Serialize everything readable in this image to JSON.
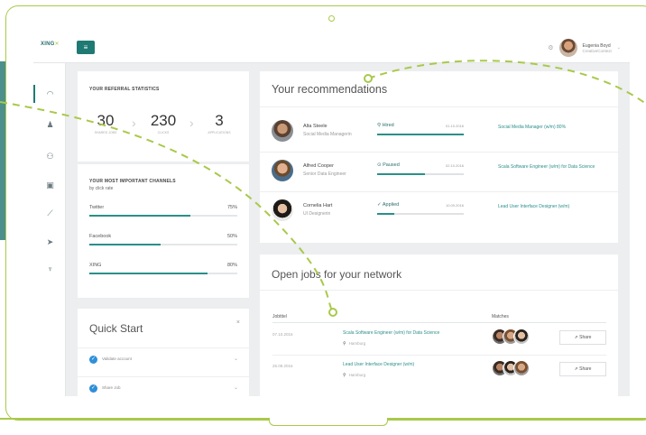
{
  "brand": {
    "logo_text": "XING",
    "accent": "#1f7a73",
    "highlight": "#a9c94a",
    "link": "#2a8f89"
  },
  "topbar": {
    "user_name": "Eugenia Boyd",
    "user_company": "CreativeContext"
  },
  "sidebar": {
    "items": [
      {
        "icon": "dashboard-icon"
      },
      {
        "icon": "person-icon"
      },
      {
        "icon": "people-icon"
      },
      {
        "icon": "briefcase-icon"
      },
      {
        "icon": "chart-icon"
      },
      {
        "icon": "send-icon"
      },
      {
        "icon": "trophy-icon"
      }
    ]
  },
  "referral_stats": {
    "title": "YOUR REFERRAL STATISTICS",
    "items": [
      {
        "value": "30",
        "label": "SHARED JOBS"
      },
      {
        "value": "230",
        "label": "CLICKS"
      },
      {
        "value": "3",
        "label": "APPLICATIONS"
      }
    ]
  },
  "channels": {
    "title": "YOUR MOST IMPORTANT CHANNELS",
    "subtitle": "by click rate",
    "items": [
      {
        "name": "Twitter",
        "percent": "75%",
        "fraction": 0.68
      },
      {
        "name": "Facebook",
        "percent": "50%",
        "fraction": 0.48
      },
      {
        "name": "XING",
        "percent": "80%",
        "fraction": 0.8
      }
    ]
  },
  "quick_start": {
    "title": "Quick Start",
    "close": "×",
    "items": [
      {
        "label": "Validate account"
      },
      {
        "label": "Share Job"
      }
    ]
  },
  "recommendations": {
    "title": "Your recommendations",
    "rows": [
      {
        "name": "Alta Steele",
        "role": "Social Media Managerin",
        "status": "Hired",
        "status_icon": "⚲",
        "date": "01.10.2016",
        "progress": 1.0,
        "job": "Social Media Manager (w/m) 80%"
      },
      {
        "name": "Alfred Cooper",
        "role": "Senior Data Engineer",
        "status": "Paused",
        "status_icon": "⊙",
        "date": "02.10.2016",
        "progress": 0.55,
        "job": "Scala Software Engineer (w/m) for Data Science"
      },
      {
        "name": "Cornelia Hart",
        "role": "UI Designerin",
        "status": "Applied",
        "status_icon": "✓",
        "date": "10.09.2016",
        "progress": 0.2,
        "job": "Lead User Interface Designer (w/m)"
      }
    ]
  },
  "open_jobs": {
    "title": "Open jobs for your network",
    "headers": {
      "jobtitel": "Jobtitel",
      "matches": "Matches"
    },
    "rows": [
      {
        "date": "07.10.2016",
        "title": "Scala Software Engineer (w/m) for Data Science",
        "location": "Hamburg",
        "share": "Share"
      },
      {
        "date": "26.09.2016",
        "title": "Lead User Interface Designer (w/m)",
        "location": "Hamburg",
        "share": "Share"
      }
    ]
  }
}
